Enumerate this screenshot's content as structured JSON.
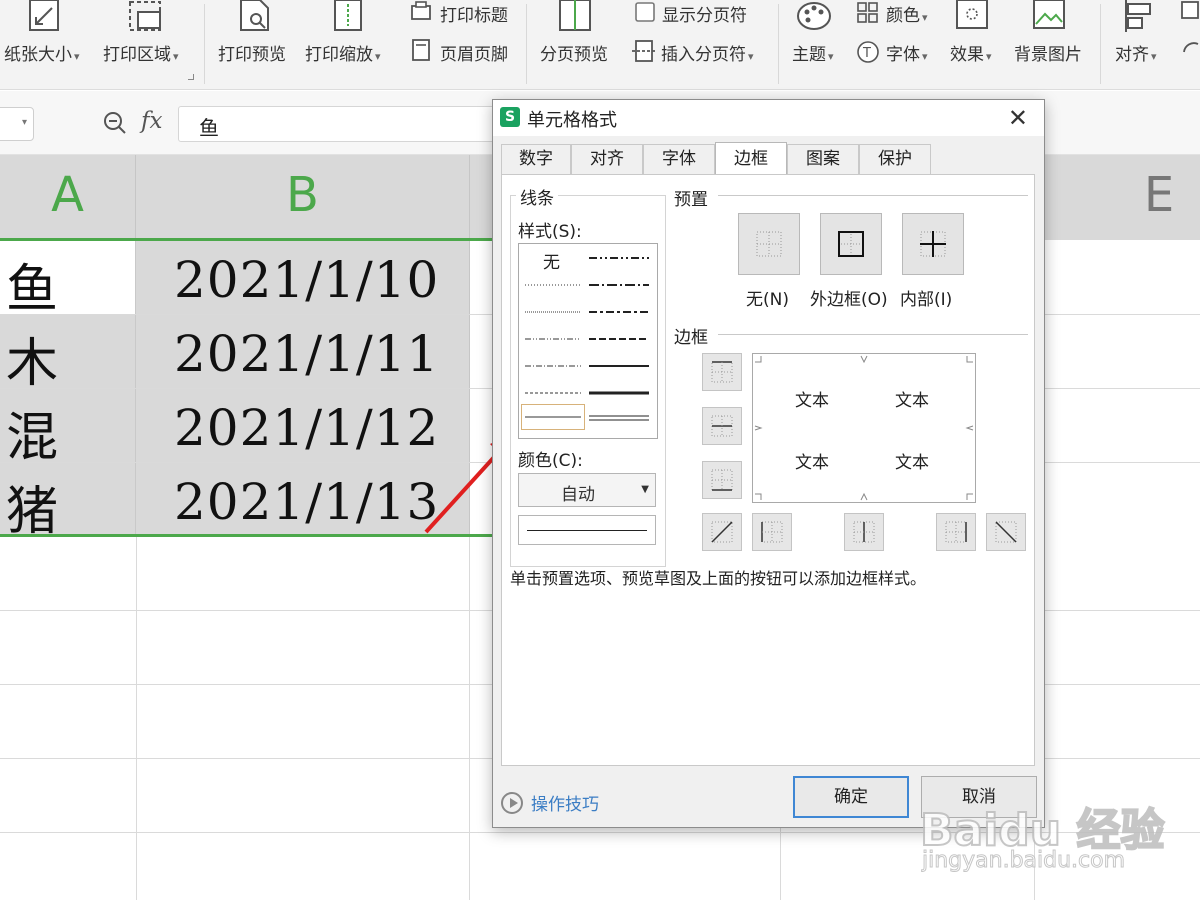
{
  "ribbon": {
    "paper_size": "纸张大小",
    "print_area": "打印区域",
    "print_preview": "打印预览",
    "print_scale": "打印缩放",
    "print_titles": "打印标题",
    "header_footer": "页眉页脚",
    "page_break_preview": "分页预览",
    "show_page_breaks": "显示分页符",
    "insert_page_break": "插入分页符",
    "theme": "主题",
    "colors": "颜色",
    "fonts": "字体",
    "effects": "效果",
    "background_image": "背景图片",
    "align": "对齐"
  },
  "formula_bar": {
    "fx": "fx",
    "value": "鱼"
  },
  "sheet": {
    "columns": [
      "A",
      "B",
      "E"
    ],
    "rows": [
      {
        "a": "鱼",
        "b": "2021/1/10"
      },
      {
        "a": "木",
        "b": "2021/1/11"
      },
      {
        "a": "混",
        "b": "2021/1/12"
      },
      {
        "a": "猪",
        "b": "2021/1/13"
      }
    ]
  },
  "dialog": {
    "title": "单元格格式",
    "logo": "S",
    "close": "✕",
    "tabs": [
      "数字",
      "对齐",
      "字体",
      "边框",
      "图案",
      "保护"
    ],
    "active_tab": "边框",
    "line_group": "线条",
    "style_label": "样式(S):",
    "style_none": "无",
    "color_label": "颜色(C):",
    "color_value": "自动",
    "preset_group": "预置",
    "preset_none": "无(N)",
    "preset_outline": "外边框(O)",
    "preset_inside": "内部(I)",
    "border_group": "边框",
    "preview_text": [
      "文本",
      "文本",
      "文本",
      "文本"
    ],
    "hint": "单击预置选项、预览草图及上面的按钮可以添加边框样式。",
    "tips": "操作技巧",
    "ok": "确定",
    "cancel": "取消"
  },
  "watermark": {
    "main": "Baidu 经验",
    "sub": "jingyan.baidu.com"
  },
  "colors": {
    "accent_green": "#4ca84b",
    "link_blue": "#3b7dc4",
    "arrow_red": "#e02020"
  }
}
